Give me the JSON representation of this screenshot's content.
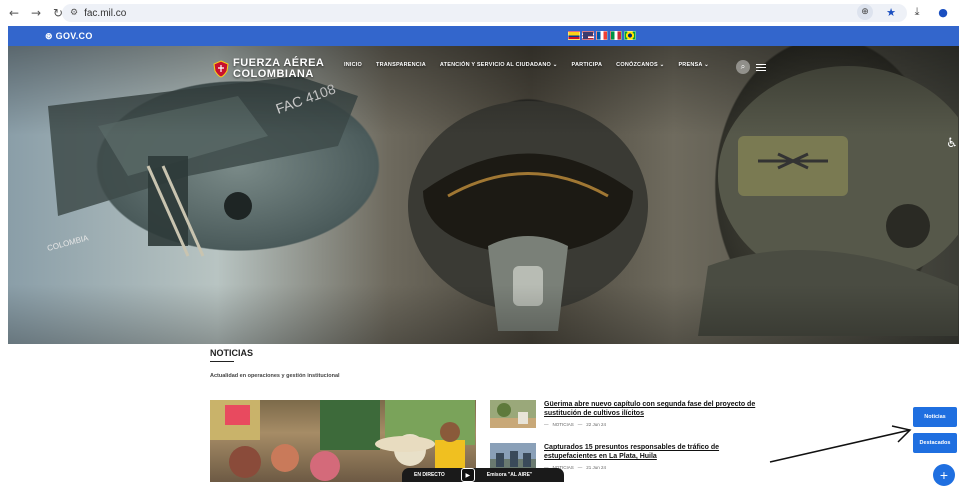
{
  "browser": {
    "url": "fac.mil.co",
    "icons": [
      "back-icon",
      "forward-icon",
      "reload-icon",
      "site-info-icon",
      "zoom-icon",
      "bookmark-star-icon",
      "download-icon",
      "profile-icon"
    ]
  },
  "gov_bar": {
    "logo": "GOV.CO",
    "flags": [
      {
        "name": "colombia-flag",
        "colors": [
          "#fcd116",
          "#003893",
          "#ce1126"
        ]
      },
      {
        "name": "usa-flag",
        "colors": [
          "#b22234",
          "#ffffff",
          "#3c3b6e"
        ]
      },
      {
        "name": "france-flag",
        "colors": [
          "#0055a4",
          "#ffffff",
          "#ef4135"
        ]
      },
      {
        "name": "italy-flag",
        "colors": [
          "#009246",
          "#ffffff",
          "#ce2b37"
        ]
      },
      {
        "name": "brazil-flag",
        "colors": [
          "#009c3b",
          "#ffdf00",
          "#002776"
        ]
      }
    ],
    "color": "#3366cc"
  },
  "header": {
    "brand_line1": "FUERZA AÉREA",
    "brand_line2": "COLOMBIANA",
    "menu": [
      {
        "label": "INICIO"
      },
      {
        "label": "TRANSPARENCIA"
      },
      {
        "label": "ATENCIÓN Y SERVICIO AL CIUDADANO ⌄"
      },
      {
        "label": "PARTICIPA"
      },
      {
        "label": "CONÓZCANOS ⌄"
      },
      {
        "label": "PRENSA ⌄"
      }
    ]
  },
  "hero": {
    "heli_tail": "FAC 4108",
    "heli_side": "COLOMBIA"
  },
  "news": {
    "title": "NOTICIAS",
    "subtitle": "Actualidad en operaciones y gestión institucional",
    "items": [
      {
        "title": "Güerima abre nuevo capítulo con segunda fase del proyecto de sustitución de cultivos ilícitos",
        "category": "NOTICIAS",
        "date": "22 Jun 24"
      },
      {
        "title": "Capturados 15 presuntos responsables de tráfico de estupefacientes en La Plata, Huila",
        "category": "NOTICIAS",
        "date": "21 Jun 24"
      }
    ]
  },
  "live": {
    "label": "EN DIRECTO",
    "station": "Emisora \"AL AIRE\""
  },
  "floating": {
    "btn1": "Noticias",
    "btn2": "Destacados",
    "plus": "+",
    "accent": "#1f6fe0"
  }
}
